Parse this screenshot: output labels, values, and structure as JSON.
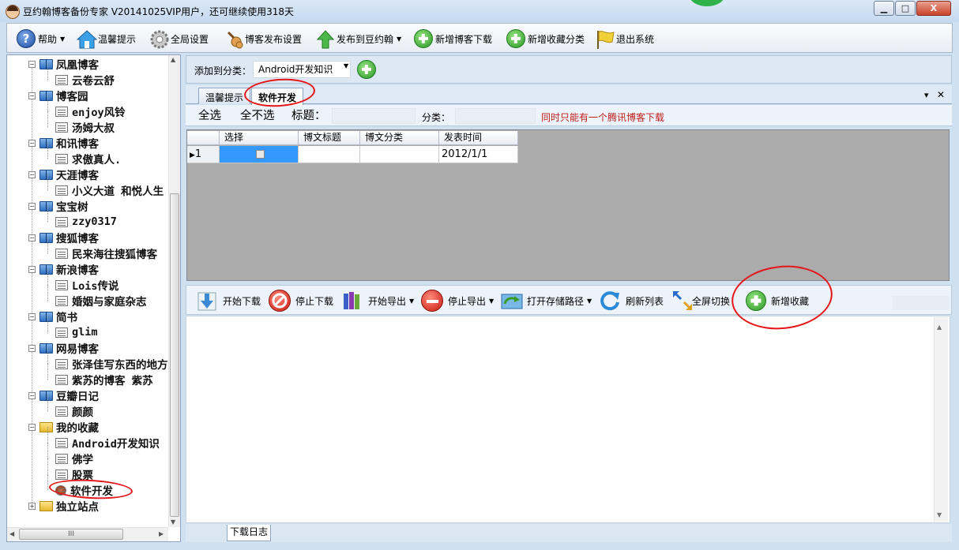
{
  "window": {
    "title": "豆约翰博客备份专家 V20141025VIP用户，还可继续使用318天",
    "min_label": "▁",
    "max_label": "□",
    "close_label": "X"
  },
  "toolbar": {
    "items": [
      {
        "label": "帮助",
        "icon": "help-icon",
        "dropdown": true
      },
      {
        "label": "温馨提示",
        "icon": "home-icon"
      },
      {
        "label": "全局设置",
        "icon": "gear-icon"
      },
      {
        "label": "博客发布设置",
        "icon": "guitar-icon"
      },
      {
        "label": "发布到豆约翰",
        "icon": "up-arrow-icon",
        "dropdown": true
      },
      {
        "label": "新增博客下载",
        "icon": "add-icon"
      },
      {
        "label": "新增收藏分类",
        "icon": "add-icon"
      },
      {
        "label": "退出系统",
        "icon": "flag-icon"
      }
    ]
  },
  "tree": {
    "nodes": [
      {
        "label": "凤凰博客",
        "type": "blog",
        "expanded": true
      },
      {
        "label": "云卷云舒",
        "type": "leaf"
      },
      {
        "label": "博客园",
        "type": "blog",
        "expanded": true
      },
      {
        "label": "enjoy风铃",
        "type": "leaf"
      },
      {
        "label": "汤姆大叔",
        "type": "leaf"
      },
      {
        "label": "和讯博客",
        "type": "blog",
        "expanded": true
      },
      {
        "label": "求傲真人.",
        "type": "leaf"
      },
      {
        "label": "天涯博客",
        "type": "blog",
        "expanded": true
      },
      {
        "label": "小义大道 和悦人生",
        "type": "leaf"
      },
      {
        "label": "宝宝树",
        "type": "blog",
        "expanded": true
      },
      {
        "label": "zzy0317",
        "type": "leaf"
      },
      {
        "label": "搜狐博客",
        "type": "blog",
        "expanded": true
      },
      {
        "label": "民来海往搜狐博客",
        "type": "leaf"
      },
      {
        "label": "新浪博客",
        "type": "blog",
        "expanded": true
      },
      {
        "label": "Lois传说",
        "type": "leaf"
      },
      {
        "label": "婚姻与家庭杂志",
        "type": "leaf"
      },
      {
        "label": "简书",
        "type": "blog",
        "expanded": true
      },
      {
        "label": "glim",
        "type": "leaf"
      },
      {
        "label": "网易博客",
        "type": "blog",
        "expanded": true
      },
      {
        "label": "张泽佳写东西的地方",
        "type": "leaf"
      },
      {
        "label": "紫苏的博客 紫苏",
        "type": "leaf"
      },
      {
        "label": "豆瓣日记",
        "type": "blog",
        "expanded": true
      },
      {
        "label": "颜颜",
        "type": "leaf"
      },
      {
        "label": "我的收藏",
        "type": "folder",
        "expanded": true
      },
      {
        "label": "Android开发知识",
        "type": "leaf"
      },
      {
        "label": "佛学",
        "type": "leaf"
      },
      {
        "label": "股票",
        "type": "leaf"
      },
      {
        "label": "软件开发",
        "type": "leaf-selected"
      },
      {
        "label": "独立站点",
        "type": "folder",
        "expanded": false
      }
    ],
    "hscroll_label": "III"
  },
  "category_bar": {
    "label": "添加到分类：",
    "selected": "Android开发知识"
  },
  "tabs": [
    {
      "label": "温馨提示",
      "active": false
    },
    {
      "label": "软件开发",
      "active": true
    }
  ],
  "tab_controls": {
    "pin": "▾",
    "close": "✕"
  },
  "filter_bar": {
    "select_all": "全选",
    "select_none": "全不选",
    "title_label": "标题：",
    "category_label": "分类：",
    "notice": "同时只能有一个腾讯博客下载"
  },
  "grid": {
    "columns": [
      "选择",
      "博文标题",
      "博文分类",
      "发表时间"
    ],
    "rows": [
      {
        "index": "1",
        "checked": false,
        "title": "",
        "category": "",
        "date": "2012/1/1"
      }
    ]
  },
  "toolbar2": {
    "items": [
      {
        "label": "开始下载",
        "icon": "download-icon"
      },
      {
        "label": "停止下载",
        "icon": "stop-icon"
      },
      {
        "label": "开始导出",
        "icon": "books-icon",
        "dropdown": true
      },
      {
        "label": "停止导出",
        "icon": "minus-icon",
        "dropdown": true
      },
      {
        "label": "打开存储路径",
        "icon": "folder-arrow-icon",
        "dropdown": true
      },
      {
        "label": "刷新列表",
        "icon": "refresh-icon"
      },
      {
        "label": "全屏切换",
        "icon": "fullscreen-icon"
      },
      {
        "label": "新增收藏",
        "icon": "add-icon"
      }
    ]
  },
  "log": {
    "tab_label": "下载日志"
  },
  "colors": {
    "annotation_red": "#e5161a",
    "grid_bg": "#ababab",
    "notice_red": "#c0201a"
  }
}
